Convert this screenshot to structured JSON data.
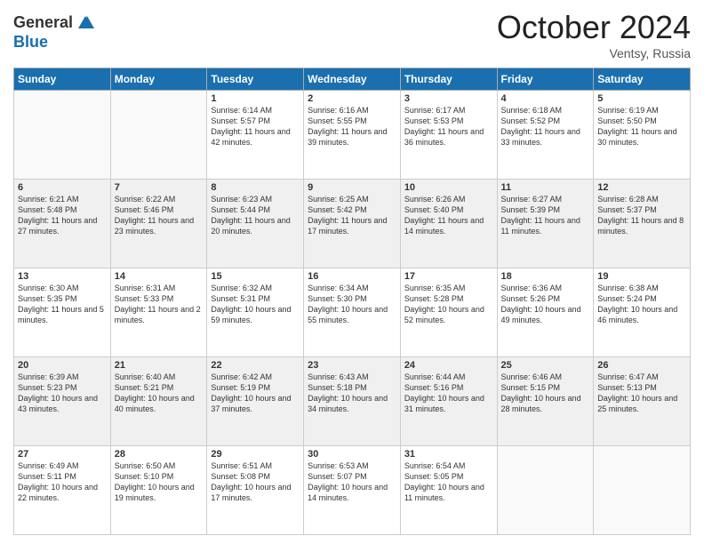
{
  "header": {
    "logo_general": "General",
    "logo_blue": "Blue",
    "month_title": "October 2024",
    "location": "Ventsy, Russia"
  },
  "days_of_week": [
    "Sunday",
    "Monday",
    "Tuesday",
    "Wednesday",
    "Thursday",
    "Friday",
    "Saturday"
  ],
  "weeks": [
    {
      "shaded": false,
      "days": [
        {
          "num": "",
          "sunrise": "",
          "sunset": "",
          "daylight": ""
        },
        {
          "num": "",
          "sunrise": "",
          "sunset": "",
          "daylight": ""
        },
        {
          "num": "1",
          "sunrise": "Sunrise: 6:14 AM",
          "sunset": "Sunset: 5:57 PM",
          "daylight": "Daylight: 11 hours and 42 minutes."
        },
        {
          "num": "2",
          "sunrise": "Sunrise: 6:16 AM",
          "sunset": "Sunset: 5:55 PM",
          "daylight": "Daylight: 11 hours and 39 minutes."
        },
        {
          "num": "3",
          "sunrise": "Sunrise: 6:17 AM",
          "sunset": "Sunset: 5:53 PM",
          "daylight": "Daylight: 11 hours and 36 minutes."
        },
        {
          "num": "4",
          "sunrise": "Sunrise: 6:18 AM",
          "sunset": "Sunset: 5:52 PM",
          "daylight": "Daylight: 11 hours and 33 minutes."
        },
        {
          "num": "5",
          "sunrise": "Sunrise: 6:19 AM",
          "sunset": "Sunset: 5:50 PM",
          "daylight": "Daylight: 11 hours and 30 minutes."
        }
      ]
    },
    {
      "shaded": true,
      "days": [
        {
          "num": "6",
          "sunrise": "Sunrise: 6:21 AM",
          "sunset": "Sunset: 5:48 PM",
          "daylight": "Daylight: 11 hours and 27 minutes."
        },
        {
          "num": "7",
          "sunrise": "Sunrise: 6:22 AM",
          "sunset": "Sunset: 5:46 PM",
          "daylight": "Daylight: 11 hours and 23 minutes."
        },
        {
          "num": "8",
          "sunrise": "Sunrise: 6:23 AM",
          "sunset": "Sunset: 5:44 PM",
          "daylight": "Daylight: 11 hours and 20 minutes."
        },
        {
          "num": "9",
          "sunrise": "Sunrise: 6:25 AM",
          "sunset": "Sunset: 5:42 PM",
          "daylight": "Daylight: 11 hours and 17 minutes."
        },
        {
          "num": "10",
          "sunrise": "Sunrise: 6:26 AM",
          "sunset": "Sunset: 5:40 PM",
          "daylight": "Daylight: 11 hours and 14 minutes."
        },
        {
          "num": "11",
          "sunrise": "Sunrise: 6:27 AM",
          "sunset": "Sunset: 5:39 PM",
          "daylight": "Daylight: 11 hours and 11 minutes."
        },
        {
          "num": "12",
          "sunrise": "Sunrise: 6:28 AM",
          "sunset": "Sunset: 5:37 PM",
          "daylight": "Daylight: 11 hours and 8 minutes."
        }
      ]
    },
    {
      "shaded": false,
      "days": [
        {
          "num": "13",
          "sunrise": "Sunrise: 6:30 AM",
          "sunset": "Sunset: 5:35 PM",
          "daylight": "Daylight: 11 hours and 5 minutes."
        },
        {
          "num": "14",
          "sunrise": "Sunrise: 6:31 AM",
          "sunset": "Sunset: 5:33 PM",
          "daylight": "Daylight: 11 hours and 2 minutes."
        },
        {
          "num": "15",
          "sunrise": "Sunrise: 6:32 AM",
          "sunset": "Sunset: 5:31 PM",
          "daylight": "Daylight: 10 hours and 59 minutes."
        },
        {
          "num": "16",
          "sunrise": "Sunrise: 6:34 AM",
          "sunset": "Sunset: 5:30 PM",
          "daylight": "Daylight: 10 hours and 55 minutes."
        },
        {
          "num": "17",
          "sunrise": "Sunrise: 6:35 AM",
          "sunset": "Sunset: 5:28 PM",
          "daylight": "Daylight: 10 hours and 52 minutes."
        },
        {
          "num": "18",
          "sunrise": "Sunrise: 6:36 AM",
          "sunset": "Sunset: 5:26 PM",
          "daylight": "Daylight: 10 hours and 49 minutes."
        },
        {
          "num": "19",
          "sunrise": "Sunrise: 6:38 AM",
          "sunset": "Sunset: 5:24 PM",
          "daylight": "Daylight: 10 hours and 46 minutes."
        }
      ]
    },
    {
      "shaded": true,
      "days": [
        {
          "num": "20",
          "sunrise": "Sunrise: 6:39 AM",
          "sunset": "Sunset: 5:23 PM",
          "daylight": "Daylight: 10 hours and 43 minutes."
        },
        {
          "num": "21",
          "sunrise": "Sunrise: 6:40 AM",
          "sunset": "Sunset: 5:21 PM",
          "daylight": "Daylight: 10 hours and 40 minutes."
        },
        {
          "num": "22",
          "sunrise": "Sunrise: 6:42 AM",
          "sunset": "Sunset: 5:19 PM",
          "daylight": "Daylight: 10 hours and 37 minutes."
        },
        {
          "num": "23",
          "sunrise": "Sunrise: 6:43 AM",
          "sunset": "Sunset: 5:18 PM",
          "daylight": "Daylight: 10 hours and 34 minutes."
        },
        {
          "num": "24",
          "sunrise": "Sunrise: 6:44 AM",
          "sunset": "Sunset: 5:16 PM",
          "daylight": "Daylight: 10 hours and 31 minutes."
        },
        {
          "num": "25",
          "sunrise": "Sunrise: 6:46 AM",
          "sunset": "Sunset: 5:15 PM",
          "daylight": "Daylight: 10 hours and 28 minutes."
        },
        {
          "num": "26",
          "sunrise": "Sunrise: 6:47 AM",
          "sunset": "Sunset: 5:13 PM",
          "daylight": "Daylight: 10 hours and 25 minutes."
        }
      ]
    },
    {
      "shaded": false,
      "days": [
        {
          "num": "27",
          "sunrise": "Sunrise: 6:49 AM",
          "sunset": "Sunset: 5:11 PM",
          "daylight": "Daylight: 10 hours and 22 minutes."
        },
        {
          "num": "28",
          "sunrise": "Sunrise: 6:50 AM",
          "sunset": "Sunset: 5:10 PM",
          "daylight": "Daylight: 10 hours and 19 minutes."
        },
        {
          "num": "29",
          "sunrise": "Sunrise: 6:51 AM",
          "sunset": "Sunset: 5:08 PM",
          "daylight": "Daylight: 10 hours and 17 minutes."
        },
        {
          "num": "30",
          "sunrise": "Sunrise: 6:53 AM",
          "sunset": "Sunset: 5:07 PM",
          "daylight": "Daylight: 10 hours and 14 minutes."
        },
        {
          "num": "31",
          "sunrise": "Sunrise: 6:54 AM",
          "sunset": "Sunset: 5:05 PM",
          "daylight": "Daylight: 10 hours and 11 minutes."
        },
        {
          "num": "",
          "sunrise": "",
          "sunset": "",
          "daylight": ""
        },
        {
          "num": "",
          "sunrise": "",
          "sunset": "",
          "daylight": ""
        }
      ]
    }
  ]
}
